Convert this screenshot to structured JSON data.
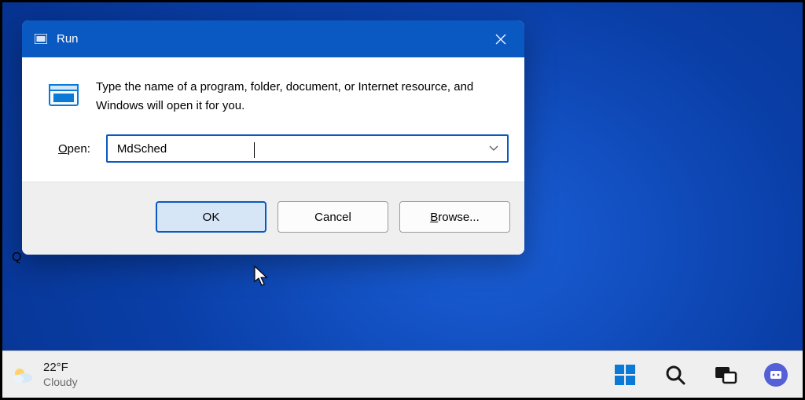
{
  "dialog": {
    "title": "Run",
    "description": "Type the name of a program, folder, document, or Internet resource, and Windows will open it for you.",
    "open_label_underline": "O",
    "open_label_rest": "pen:",
    "input_value": "MdSched",
    "buttons": {
      "ok": "OK",
      "cancel": "Cancel",
      "browse_underline": "B",
      "browse_rest": "rowse..."
    }
  },
  "taskbar": {
    "weather": {
      "temp": "22°F",
      "condition": "Cloudy"
    }
  },
  "stray": {
    "q": "Q"
  }
}
